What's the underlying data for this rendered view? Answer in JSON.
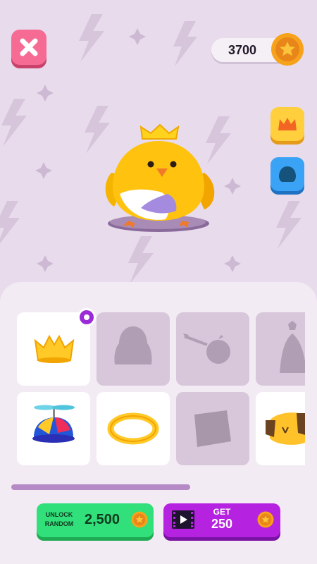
{
  "header": {
    "coins": "3700",
    "close_icon": "close-icon",
    "coin_icon": "coin-star-icon"
  },
  "side_buttons": [
    {
      "name": "crown-category",
      "icon": "crown-icon",
      "color": "#ffcf3d"
    },
    {
      "name": "bird-category",
      "icon": "bird-silhouette-icon",
      "color": "#3aa3f5"
    }
  ],
  "inventory": {
    "items": [
      {
        "name": "gold-crown",
        "owned": true,
        "selected": true
      },
      {
        "name": "hood",
        "owned": false
      },
      {
        "name": "arrow-apple",
        "owned": false
      },
      {
        "name": "wizard-hat",
        "owned": false
      },
      {
        "name": "propeller-cap",
        "owned": true
      },
      {
        "name": "halo",
        "owned": true
      },
      {
        "name": "box",
        "owned": false
      },
      {
        "name": "dog-mask",
        "owned": true
      }
    ]
  },
  "actions": {
    "unlock_label_line1": "UNLOCK",
    "unlock_label_line2": "RANDOM",
    "unlock_price": "2,500",
    "get_label": "GET",
    "get_amount": "250"
  },
  "colors": {
    "background": "#e8dcec",
    "panel": "#f3ebf4",
    "locked_slot": "#d8c6da",
    "unlock_green": "#31e07b",
    "get_purple": "#b523e0",
    "close_pink": "#f56b94",
    "selected_marker": "#9a2bd6"
  }
}
